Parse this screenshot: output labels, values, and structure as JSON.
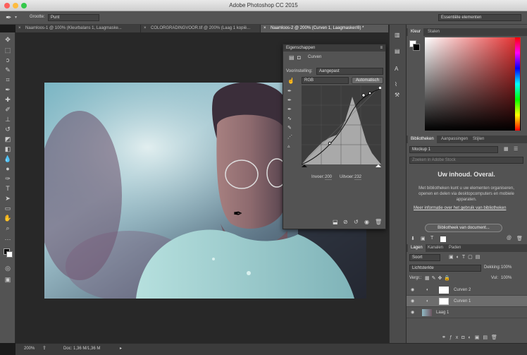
{
  "window": {
    "title": "Adobe Photoshop CC 2015"
  },
  "options_bar": {
    "sample_size_label": "Grootte:",
    "sample_size_value": "Punt",
    "workspace_value": "Essentiële elementen"
  },
  "doc_tabs": [
    {
      "label": "Naamloos-1 @ 100% (Kleurbalans 1, Laagmaske...",
      "active": false
    },
    {
      "label": "COLORGRADINGVOOR.tif @ 200% (Laag 1 kopië...",
      "active": false
    },
    {
      "label": "Naamloos-2 @ 200% (Curven 1, Laagmasker/8) *",
      "active": true
    }
  ],
  "properties": {
    "panel_title": "Eigenschappen",
    "adjustment_label": "Curven",
    "preset_label": "Voorinstelling:",
    "preset_value": "Aangepast",
    "channel_value": "RGB",
    "auto_button": "Automatisch",
    "input_label": "Invoer:",
    "input_value": "200",
    "output_label": "Uitvoer:",
    "output_value": "232"
  },
  "color_panel": {
    "tabs": [
      "Kleur",
      "Stalen"
    ]
  },
  "libraries_panel": {
    "tabs": [
      "Bibliotheken",
      "Aanpassingen",
      "Stijlen"
    ],
    "library_select": "Mockup 1",
    "search_placeholder": "Zoeken in Adobe Stock",
    "heading": "Uw inhoud. Overal.",
    "body": "Met bibliotheken kunt u uw elementen organiseren, openen en delen via desktopcomputers en mobiele apparaten.",
    "link": "Meer informatie over het gebruik van bibliotheken",
    "button": "Bibliotheek van document..."
  },
  "layers_panel": {
    "tabs": [
      "Lagen",
      "Kanalen",
      "Paden"
    ],
    "filter_value": "Soort",
    "blend_mode": "Lichtsterkte",
    "opacity_label": "Dekking:",
    "opacity_value": "100%",
    "lock_label": "Vergr.:",
    "fill_label": "Vul:",
    "fill_value": "100%",
    "layers": [
      {
        "name": "Curven 2",
        "selected": false
      },
      {
        "name": "Curven 1",
        "selected": true
      },
      {
        "name": "Laag 1",
        "selected": false
      }
    ]
  },
  "status_bar": {
    "zoom": "200%",
    "doc_info": "Doc: 1,36 M/1,36 M"
  },
  "icons": [
    "eyedropper-icon",
    "move-icon",
    "marquee-icon",
    "lasso-icon",
    "quick-select-icon",
    "crop-icon",
    "brush-icon",
    "stamp-icon",
    "eraser-icon",
    "gradient-icon",
    "pen-icon",
    "type-icon",
    "hand-icon",
    "zoom-icon",
    "eye-icon"
  ]
}
